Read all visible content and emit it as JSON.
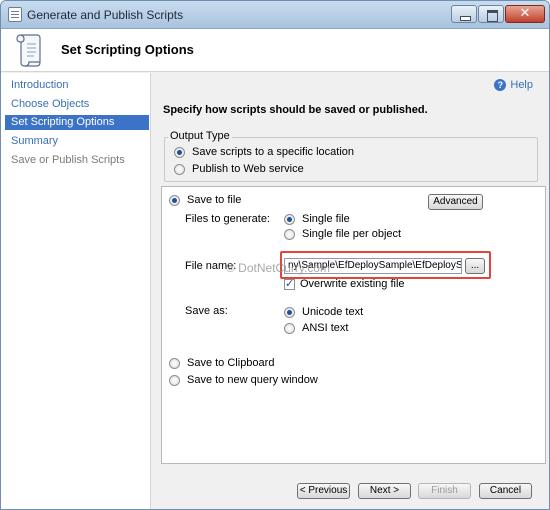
{
  "window": {
    "title": "Generate and Publish Scripts",
    "close_symbol": "✕"
  },
  "header": {
    "title": "Set Scripting Options",
    "icon": "scroll-icon"
  },
  "sidebar": {
    "items": [
      {
        "label": "Introduction",
        "state": "link"
      },
      {
        "label": "Choose Objects",
        "state": "link"
      },
      {
        "label": "Set Scripting Options",
        "state": "active"
      },
      {
        "label": "Summary",
        "state": "link"
      },
      {
        "label": "Save or Publish Scripts",
        "state": "disabled"
      }
    ]
  },
  "help": {
    "label": "Help",
    "icon_glyph": "?"
  },
  "main": {
    "instructions": "Specify how scripts should be saved or published.",
    "output_type": {
      "label": "Output Type",
      "options": [
        {
          "label": "Save scripts to a specific location",
          "selected": true
        },
        {
          "label": "Publish to Web service",
          "selected": false
        }
      ]
    },
    "save_to_file": {
      "label": "Save to file",
      "selected": true,
      "advanced_label": "Advanced",
      "files_to_generate_label": "Files to generate:",
      "files_options": [
        {
          "label": "Single file",
          "selected": true
        },
        {
          "label": "Single file per object",
          "selected": false
        }
      ],
      "file_name_label": "File name:",
      "file_name_value": "ny\\Sample\\EfDeploySample\\EfDeploySample.sql",
      "browse_label": "...",
      "overwrite_label": "Overwrite existing file",
      "overwrite_checked": true,
      "save_as_label": "Save as:",
      "save_as_options": [
        {
          "label": "Unicode text",
          "selected": true
        },
        {
          "label": "ANSI text",
          "selected": false
        }
      ]
    },
    "save_to_clipboard": {
      "label": "Save to Clipboard",
      "selected": false
    },
    "save_to_query": {
      "label": "Save to new query window",
      "selected": false
    },
    "watermark": "© DotNetCurry.com"
  },
  "footer": {
    "previous_label": "< Previous",
    "next_label": "Next >",
    "finish_label": "Finish",
    "cancel_label": "Cancel"
  },
  "colors": {
    "accent": "#3d73c6",
    "link": "#3a6fb6",
    "highlight_border": "#e0473a"
  }
}
